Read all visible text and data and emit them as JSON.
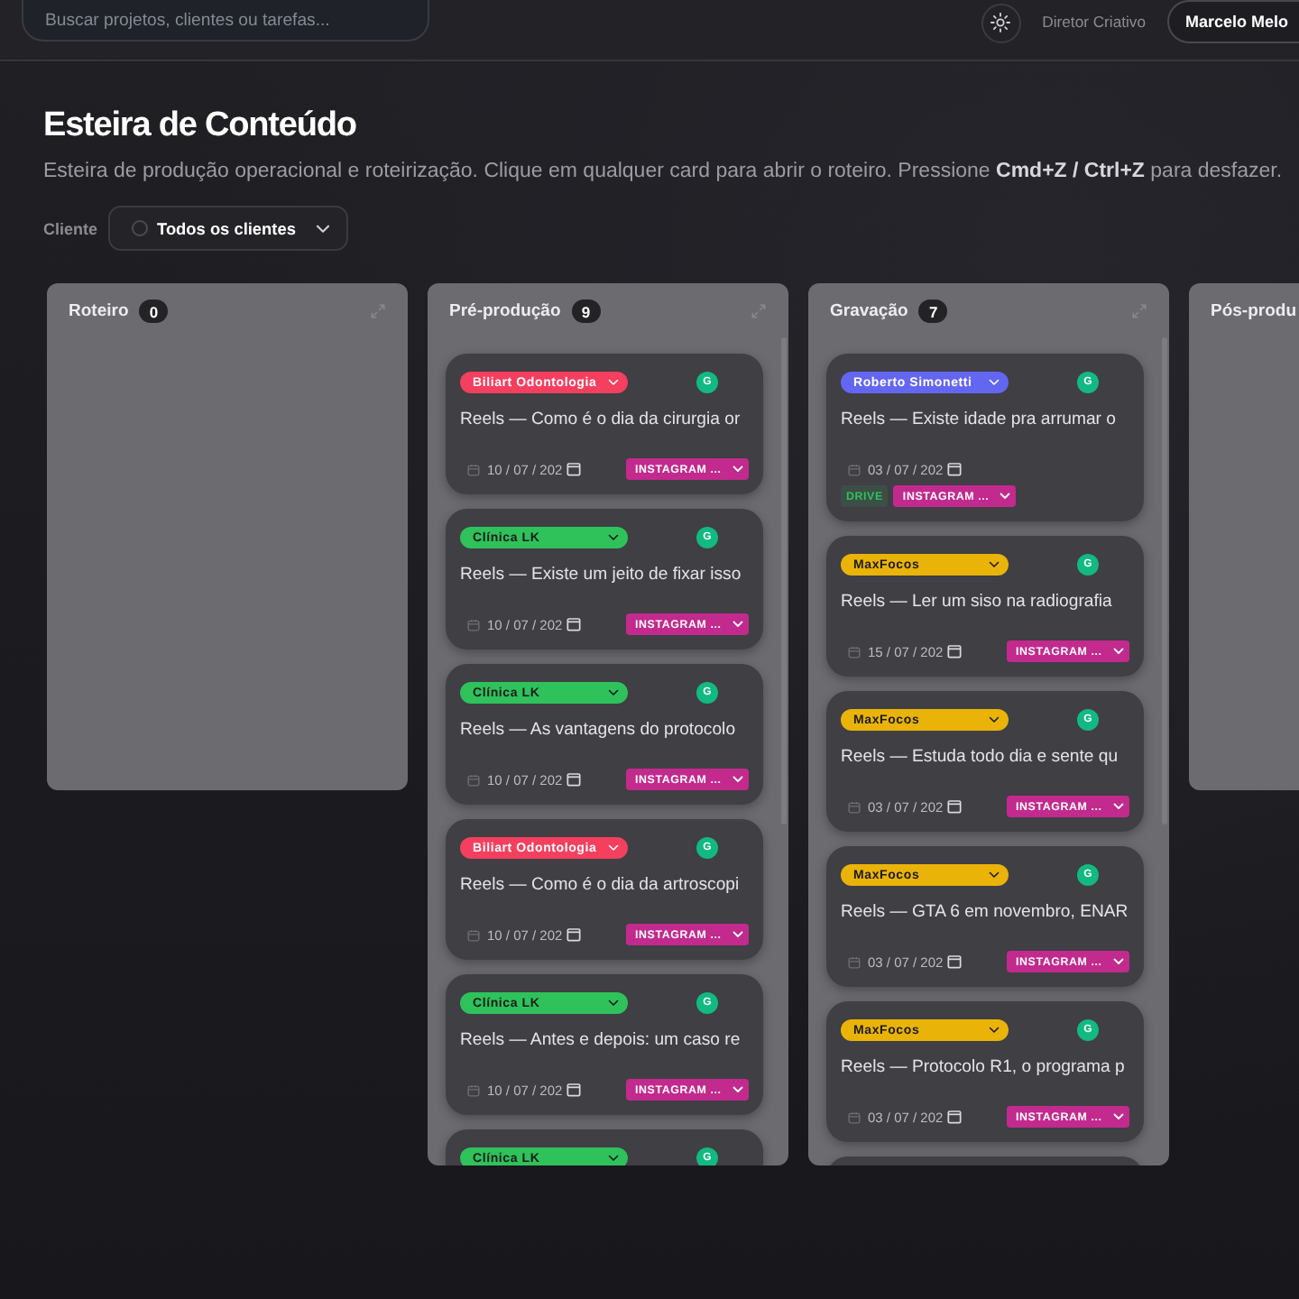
{
  "topbar": {
    "search": {
      "placeholder": "Buscar projetos, clientes ou tarefas..."
    },
    "role": "Diretor Criativo",
    "user": "Marcelo Melo"
  },
  "header": {
    "title": "Esteira de Conteúdo",
    "subtitle": "Esteira de produção operacional e roteirização. Clique em qualquer card para abrir o roteiro. Pressione **Cmd+Z / Ctrl+Z** para desfazer."
  },
  "filter": {
    "label": "Cliente",
    "value": "Todos os clientes"
  },
  "columns": [
    {
      "title": "Roteiro",
      "count": "0"
    },
    {
      "title": "Pré-produção",
      "count": "9",
      "cards": [
        {
          "client": "Biliart Odontologia",
          "color": "#f43f5e",
          "avatar": "G",
          "title": "Reels — Como é o dia da cirurgia or",
          "date": "10 / 07 / 202",
          "tags": [
            {
              "kind": "channel",
              "label": "INSTAGRAM ..."
            }
          ]
        },
        {
          "client": "Clínica LK",
          "color": "#2fc25b",
          "avatar": "G",
          "title": "Reels — Existe um jeito de fixar isso",
          "date": "10 / 07 / 202",
          "tags": [
            {
              "kind": "channel",
              "label": "INSTAGRAM ..."
            }
          ]
        },
        {
          "client": "Clínica LK",
          "color": "#2fc25b",
          "avatar": "G",
          "title": "Reels — As vantagens do protocolo",
          "date": "10 / 07 / 202",
          "tags": [
            {
              "kind": "channel",
              "label": "INSTAGRAM ..."
            }
          ]
        },
        {
          "client": "Biliart Odontologia",
          "color": "#f43f5e",
          "avatar": "G",
          "title": "Reels — Como é o dia da artroscopi",
          "date": "10 / 07 / 202",
          "tags": [
            {
              "kind": "channel",
              "label": "INSTAGRAM ..."
            }
          ]
        },
        {
          "client": "Clínica LK",
          "color": "#2fc25b",
          "avatar": "G",
          "title": "Reels — Antes e depois: um caso re",
          "date": "10 / 07 / 202",
          "tags": [
            {
              "kind": "channel",
              "label": "INSTAGRAM ..."
            }
          ]
        },
        {
          "client": "Clínica LK",
          "color": "#2fc25b",
          "avatar": "G"
        }
      ]
    },
    {
      "title": "Gravação",
      "count": "7",
      "more_below": true,
      "cards": [
        {
          "client": "Roberto Simonetti",
          "color": "#6366f1",
          "avatar": "G",
          "title": "Reels — Existe idade pra arrumar o",
          "date": "03 / 07 / 202",
          "tags": [
            {
              "kind": "drive",
              "label": "DRIVE"
            },
            {
              "kind": "channel",
              "label": "INSTAGRAM ..."
            }
          ]
        },
        {
          "client": "MaxFocos",
          "color": "#eab308",
          "avatar": "G",
          "title": "Reels — Ler um siso na radiografia",
          "date": "15 / 07 / 202",
          "tags": [
            {
              "kind": "channel",
              "label": "INSTAGRAM ..."
            }
          ]
        },
        {
          "client": "MaxFocos",
          "color": "#eab308",
          "avatar": "G",
          "title": "Reels — Estuda todo dia e sente qu",
          "date": "03 / 07 / 202",
          "tags": [
            {
              "kind": "channel",
              "label": "INSTAGRAM ..."
            }
          ]
        },
        {
          "client": "MaxFocos",
          "color": "#eab308",
          "avatar": "G",
          "title": "Reels — GTA 6 em novembro, ENAR",
          "date": "03 / 07 / 202",
          "tags": [
            {
              "kind": "channel",
              "label": "INSTAGRAM ..."
            }
          ]
        },
        {
          "client": "MaxFocos",
          "color": "#eab308",
          "avatar": "G",
          "title": "Reels — Protocolo R1, o programa p",
          "date": "03 / 07 / 202",
          "tags": [
            {
              "kind": "channel",
              "label": "INSTAGRAM ..."
            }
          ]
        }
      ]
    },
    {
      "title": "Pós-produ"
    }
  ]
}
